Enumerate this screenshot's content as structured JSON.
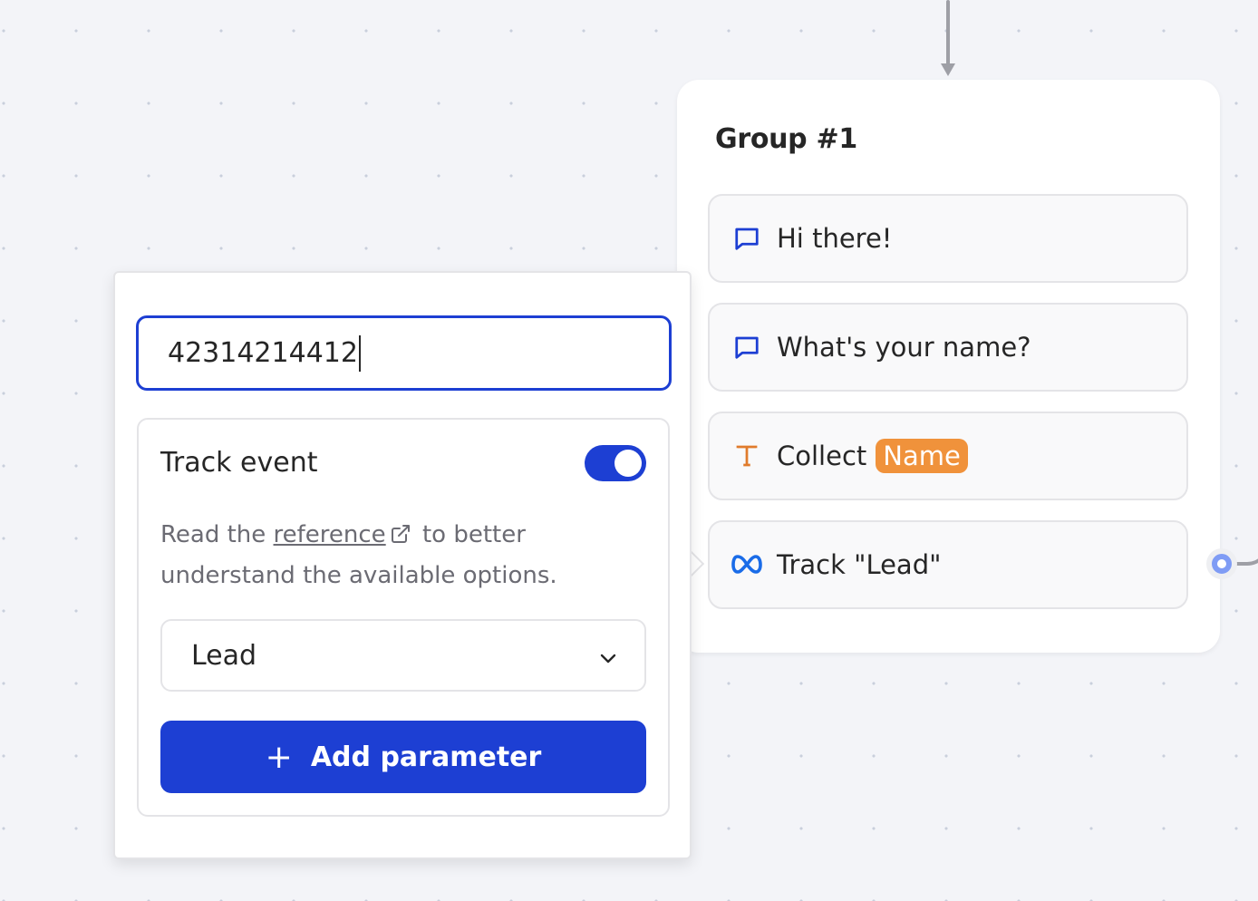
{
  "canvas": {
    "background": "#f3f4f8",
    "edge_color": "#9e9fa6"
  },
  "group": {
    "title": "Group #1",
    "blocks": [
      {
        "type": "text-bubble",
        "icon": "chat-bubble-icon",
        "label": "Hi there!"
      },
      {
        "type": "text-bubble",
        "icon": "chat-bubble-icon",
        "label": "What's your name?"
      },
      {
        "type": "text-input",
        "icon": "text-input-icon",
        "label": "Collect",
        "variable": "Name"
      },
      {
        "type": "meta-pixel",
        "icon": "meta-icon",
        "label": "Track \"Lead\""
      }
    ]
  },
  "settings": {
    "pixel_id_value": "42314214412",
    "track_event_label": "Track event",
    "track_event_enabled": true,
    "help_prefix": "Read the",
    "help_link": "reference",
    "help_suffix": "to better understand the available options.",
    "event_select_value": "Lead",
    "add_parameter_label": "Add parameter",
    "add_parameter_icon": "+"
  },
  "colors": {
    "primary": "#1d3fd3",
    "variable_badge": "#f0923b",
    "text_icon": "#e07b2c",
    "connector": "#7f9cf5",
    "meta": "#1a73e8"
  }
}
